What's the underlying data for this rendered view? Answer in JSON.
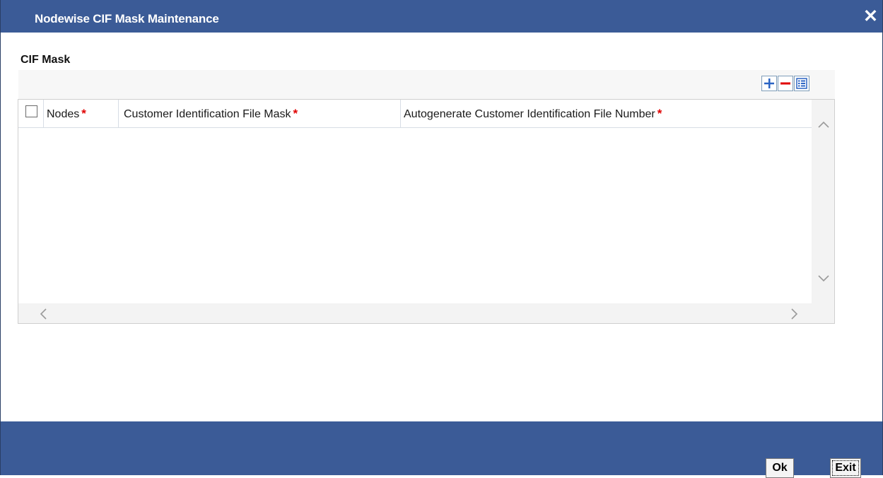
{
  "window": {
    "title": "Nodewise CIF Mask Maintenance",
    "close_glyph": "✕"
  },
  "section": {
    "title": "CIF Mask"
  },
  "toolbar": {
    "add_icon": "plus-icon",
    "remove_icon": "minus-icon",
    "view_icon": "single-view-icon"
  },
  "grid": {
    "columns": [
      {
        "label": "Nodes",
        "required_mark": "*"
      },
      {
        "label": "Customer Identification File Mask",
        "required_mark": "*"
      },
      {
        "label": "Autogenerate Customer Identification File Number",
        "required_mark": "*"
      }
    ],
    "rows": []
  },
  "footer": {
    "ok_label": "Ok",
    "exit_label": "Exit"
  },
  "colors": {
    "header_blue": "#3b5b97",
    "required_red": "#e00000",
    "icon_blue": "#2b64c4"
  }
}
